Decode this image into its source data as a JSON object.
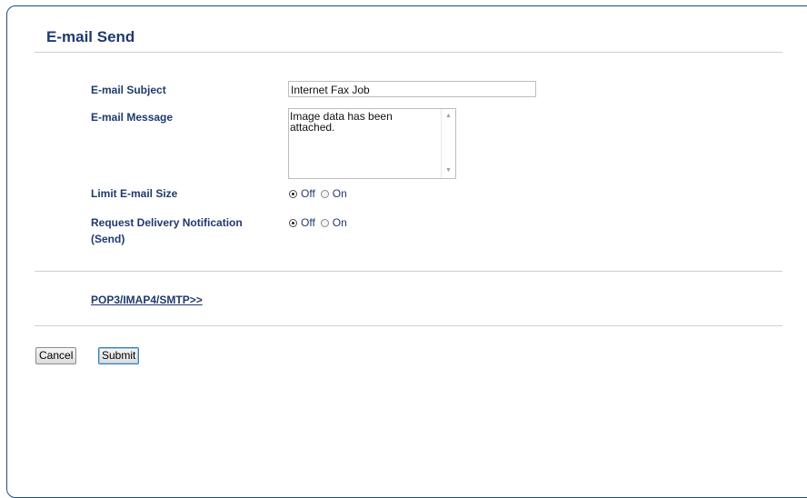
{
  "page": {
    "title": "E-mail Send"
  },
  "form": {
    "subject": {
      "label": "E-mail Subject",
      "value": "Internet Fax Job"
    },
    "message": {
      "label": "E-mail Message",
      "value": "Image data has been\nattached."
    },
    "limit_size": {
      "label": "Limit E-mail Size",
      "options": [
        {
          "label": "Off",
          "checked": true
        },
        {
          "label": "On",
          "checked": false
        }
      ]
    },
    "delivery_notification": {
      "label_line1": "Request Delivery Notification",
      "label_line2": "(Send)",
      "options": [
        {
          "label": "Off",
          "checked": true
        },
        {
          "label": "On",
          "checked": false
        }
      ]
    }
  },
  "links": {
    "protocol": "POP3/IMAP4/SMTP>>"
  },
  "buttons": {
    "cancel": "Cancel",
    "submit": "Submit"
  }
}
